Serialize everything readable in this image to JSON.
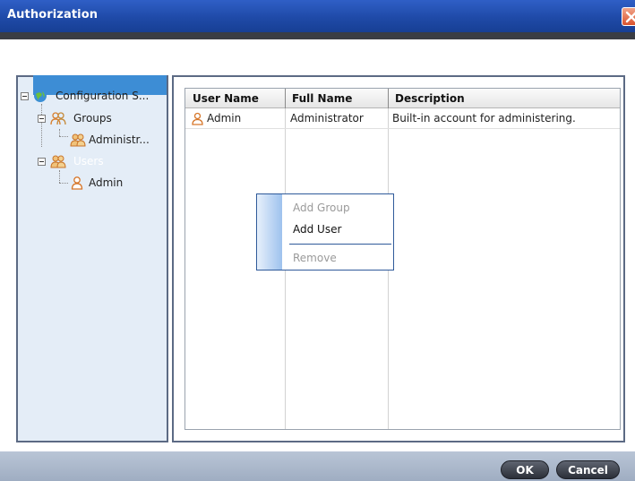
{
  "window": {
    "title": "Authorization"
  },
  "tree": {
    "root_label": "Configuration S...",
    "groups_label": "Groups",
    "group_child_label": "Administr...",
    "users_label": "Users",
    "user_child_label": "Admin"
  },
  "table": {
    "columns": [
      "User Name",
      "Full Name",
      "Description"
    ],
    "rows": [
      {
        "user_name": "Admin",
        "full_name": "Administrator",
        "description": "Built-in account for administering."
      }
    ]
  },
  "context_menu": {
    "items": [
      {
        "label": "Add Group",
        "enabled": false
      },
      {
        "label": "Add User",
        "enabled": true
      },
      {
        "label": "Remove",
        "enabled": false
      }
    ]
  },
  "footer": {
    "ok_label": "OK",
    "cancel_label": "Cancel"
  },
  "colors": {
    "titlebar": "#1f4aa8",
    "selection": "#3d8dd5",
    "tree_bg": "#e4edf7",
    "footer": "#a9b6c9"
  },
  "icons": {
    "root": "globe-icon",
    "groups": "group-icon",
    "group_item": "group-icon",
    "users": "users-icon",
    "user_item": "user-icon",
    "close": "close-icon"
  }
}
